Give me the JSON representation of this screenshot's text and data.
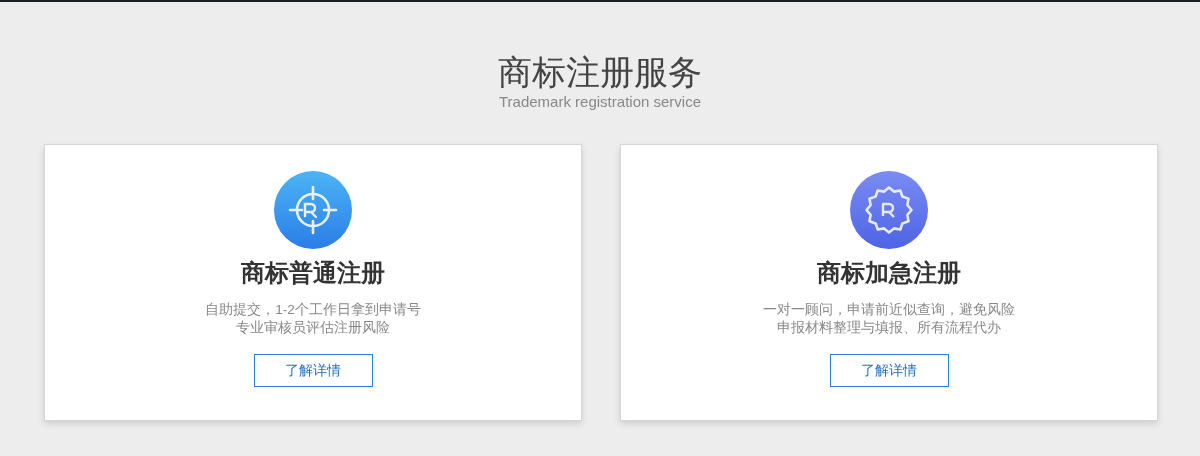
{
  "header": {
    "title": "商标注册服务",
    "subtitle": "Trademark registration service"
  },
  "cards": [
    {
      "kind": "crosshair",
      "title": "商标普通注册",
      "lines": [
        "自助提交，1-2个工作日拿到申请号",
        "专业审核员评估注册风险"
      ],
      "button": "了解详情"
    },
    {
      "kind": "badge",
      "title": "商标加急注册",
      "lines": [
        "一对一顾问，申请前近似查询，避免风险",
        "申报材料整理与填报、所有流程代办"
      ],
      "button": "了解详情"
    }
  ]
}
